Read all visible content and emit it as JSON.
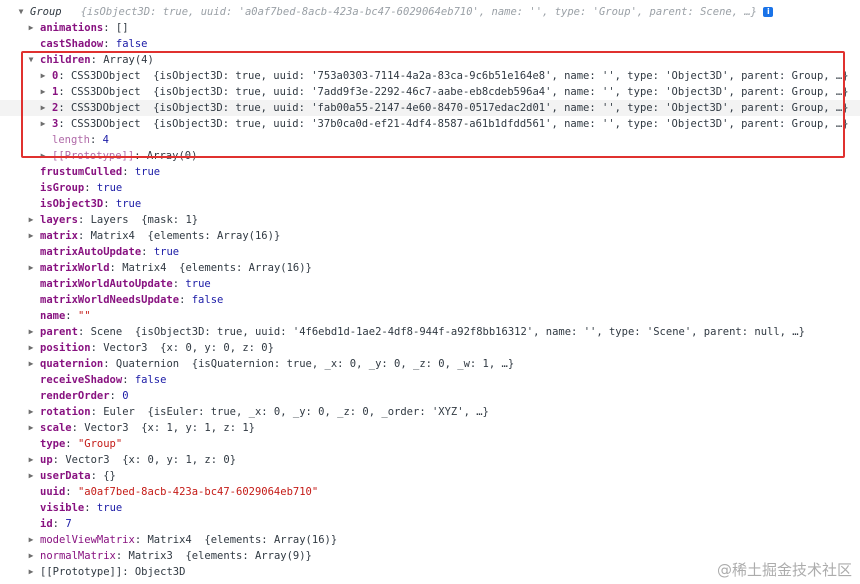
{
  "root": {
    "class": "Group",
    "preview": "{isObject3D: true, uuid: 'a0af7bed-8acb-423a-bc47-6029064eb710', name: '', type: 'Group', parent: Scene, …}"
  },
  "props": {
    "animations": {
      "key": "animations",
      "val": "[]"
    },
    "castShadow": {
      "key": "castShadow",
      "val": "false"
    },
    "children": {
      "key": "children",
      "val": "Array(4)"
    },
    "children_items": [
      {
        "key": "0",
        "class": "CSS3DObject",
        "preview": "{isObject3D: true, uuid: '753a0303-7114-4a2a-83ca-9c6b51e164e8', name: '', type: 'Object3D', parent: Group, …}"
      },
      {
        "key": "1",
        "class": "CSS3DObject",
        "preview": "{isObject3D: true, uuid: '7add9f3e-2292-46c7-aabe-eb8cdeb596a4', name: '', type: 'Object3D', parent: Group, …}"
      },
      {
        "key": "2",
        "class": "CSS3DObject",
        "preview": "{isObject3D: true, uuid: 'fab00a55-2147-4e60-8470-0517edac2d01', name: '', type: 'Object3D', parent: Group, …}"
      },
      {
        "key": "3",
        "class": "CSS3DObject",
        "preview": "{isObject3D: true, uuid: '37b0ca0d-ef21-4df4-8587-a61b1dfdd561', name: '', type: 'Object3D', parent: Group, …}"
      }
    ],
    "length": {
      "key": "length",
      "val": "4"
    },
    "children_proto": {
      "key": "[[Prototype]]",
      "val": "Array(0)"
    },
    "frustumCulled": {
      "key": "frustumCulled",
      "val": "true"
    },
    "isGroup": {
      "key": "isGroup",
      "val": "true"
    },
    "isObject3D": {
      "key": "isObject3D",
      "val": "true"
    },
    "layers": {
      "key": "layers",
      "class": "Layers",
      "val": "{mask: 1}"
    },
    "matrix": {
      "key": "matrix",
      "class": "Matrix4",
      "val": "{elements: Array(16)}"
    },
    "matrixAutoUpdate": {
      "key": "matrixAutoUpdate",
      "val": "true"
    },
    "matrixWorld": {
      "key": "matrixWorld",
      "class": "Matrix4",
      "val": "{elements: Array(16)}"
    },
    "matrixWorldAutoUpdate": {
      "key": "matrixWorldAutoUpdate",
      "val": "true"
    },
    "matrixWorldNeedsUpdate": {
      "key": "matrixWorldNeedsUpdate",
      "val": "false"
    },
    "name": {
      "key": "name",
      "val": "\"\""
    },
    "parent": {
      "key": "parent",
      "class": "Scene",
      "val": "{isObject3D: true, uuid: '4f6ebd1d-1ae2-4df8-944f-a92f8bb16312', name: '', type: 'Scene', parent: null, …}"
    },
    "position": {
      "key": "position",
      "class": "Vector3",
      "val": "{x: 0, y: 0, z: 0}"
    },
    "quaternion": {
      "key": "quaternion",
      "class": "Quaternion",
      "val": "{isQuaternion: true, _x: 0, _y: 0, _z: 0, _w: 1, …}"
    },
    "receiveShadow": {
      "key": "receiveShadow",
      "val": "false"
    },
    "renderOrder": {
      "key": "renderOrder",
      "val": "0"
    },
    "rotation": {
      "key": "rotation",
      "class": "Euler",
      "val": "{isEuler: true, _x: 0, _y: 0, _z: 0, _order: 'XYZ', …}"
    },
    "scale": {
      "key": "scale",
      "class": "Vector3",
      "val": "{x: 1, y: 1, z: 1}"
    },
    "type": {
      "key": "type",
      "val": "\"Group\""
    },
    "up": {
      "key": "up",
      "class": "Vector3",
      "val": "{x: 0, y: 1, z: 0}"
    },
    "userData": {
      "key": "userData",
      "val": "{}"
    },
    "uuid": {
      "key": "uuid",
      "val": "\"a0af7bed-8acb-423a-bc47-6029064eb710\""
    },
    "visible": {
      "key": "visible",
      "val": "true"
    },
    "id": {
      "key": "id",
      "val": "7"
    },
    "modelViewMatrix": {
      "key": "modelViewMatrix",
      "class": "Matrix4",
      "val": "{elements: Array(16)}"
    },
    "normalMatrix": {
      "key": "normalMatrix",
      "class": "Matrix3",
      "val": "{elements: Array(9)}"
    },
    "proto": {
      "key": "[[Prototype]]",
      "val": "Object3D"
    }
  },
  "icons": {
    "expanded": "triangle-down-icon",
    "collapsed": "triangle-right-icon",
    "info": "info-icon"
  },
  "colors": {
    "highlight_box": "#e0312f",
    "key": "#881280",
    "string": "#c41a16",
    "keyword": "#1a1aa6"
  },
  "watermark": "@稀土掘金技术社区"
}
